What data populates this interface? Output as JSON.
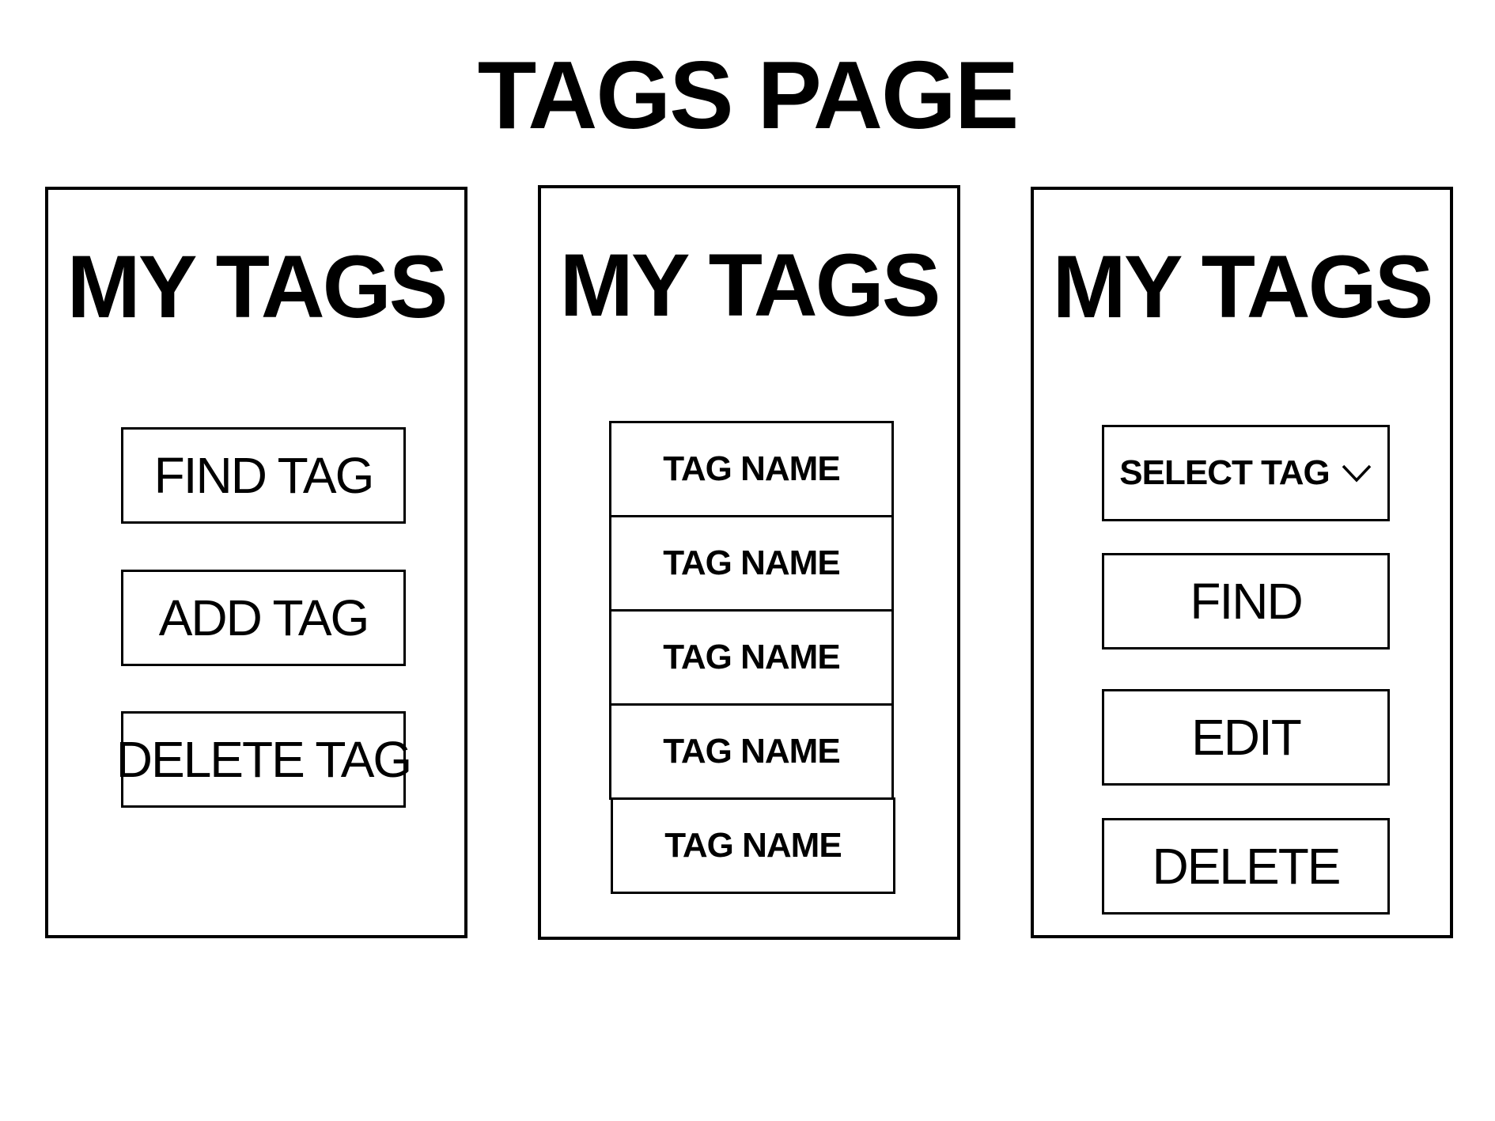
{
  "page": {
    "title": "TAGS PAGE"
  },
  "panels": {
    "left": {
      "title": "MY TAGS",
      "buttons": [
        {
          "label": "FIND TAG"
        },
        {
          "label": "ADD TAG"
        },
        {
          "label": "DELETE TAG"
        }
      ]
    },
    "middle": {
      "title": "MY TAGS",
      "tag_list": [
        {
          "label": "TAG NAME"
        },
        {
          "label": "TAG NAME"
        },
        {
          "label": "TAG NAME"
        },
        {
          "label": "TAG NAME"
        },
        {
          "label": "TAG NAME"
        }
      ]
    },
    "right": {
      "title": "MY TAGS",
      "select": {
        "label": "SELECT TAG",
        "icon": "chevron-down-icon"
      },
      "buttons": [
        {
          "label": "FIND"
        },
        {
          "label": "EDIT"
        },
        {
          "label": "DELETE"
        }
      ]
    }
  },
  "colors": {
    "background": "#ffffff",
    "foreground": "#000000"
  }
}
